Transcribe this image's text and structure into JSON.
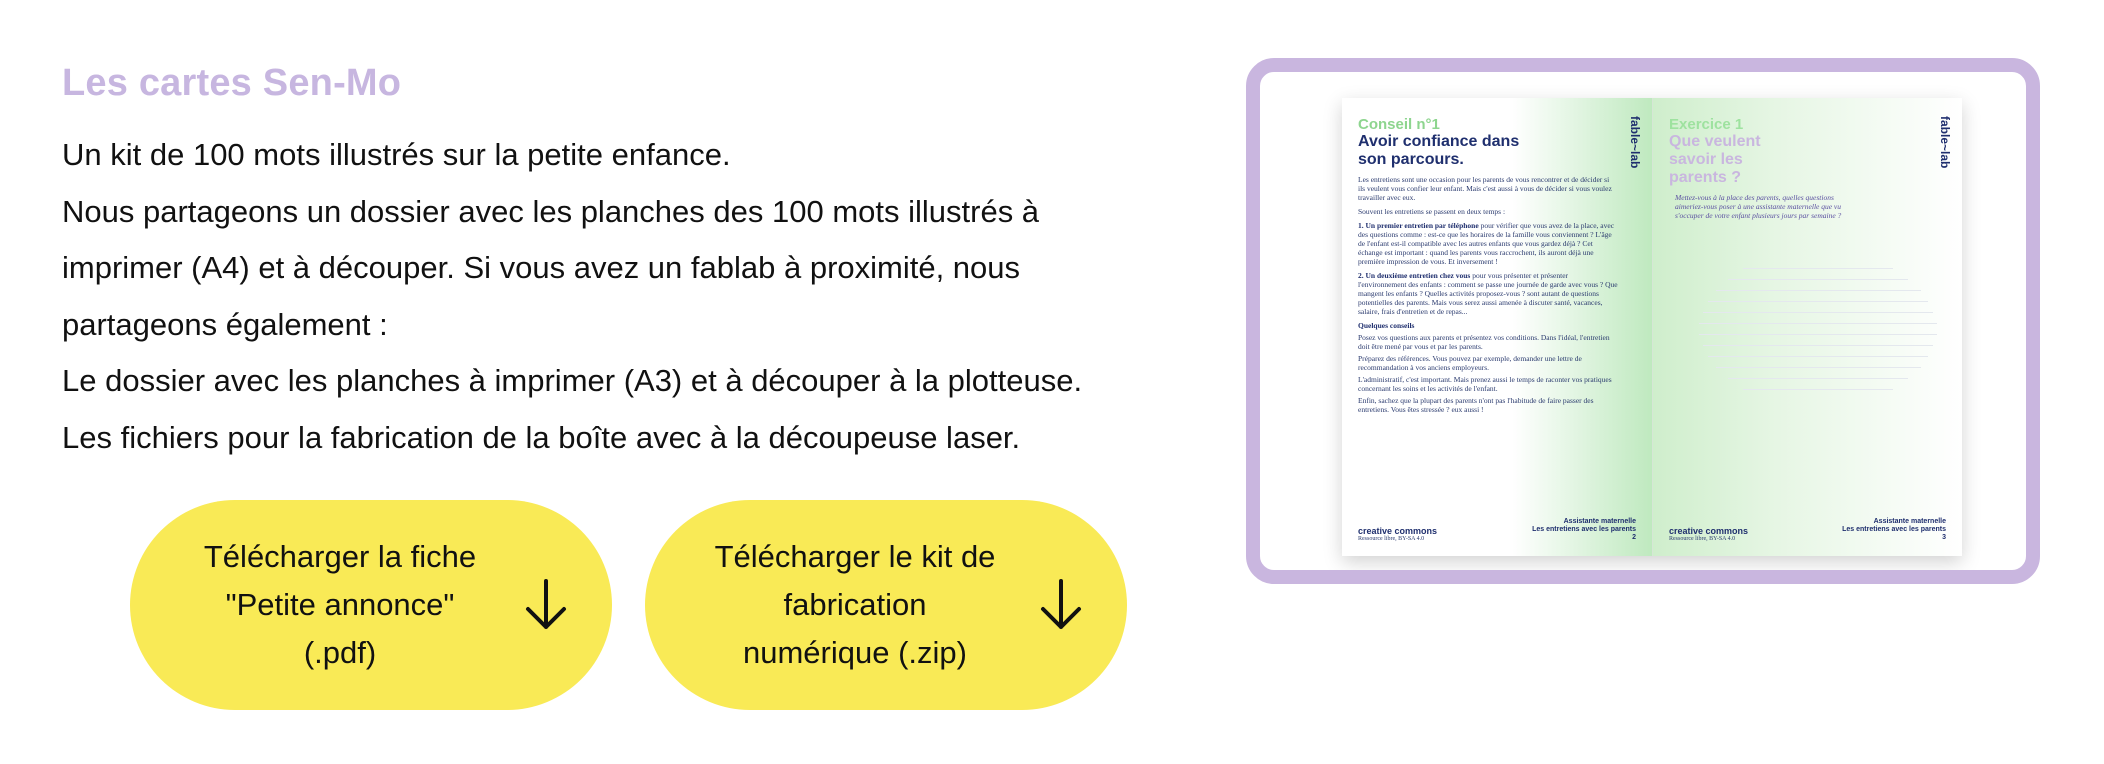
{
  "section": {
    "title": "Les cartes Sen-Mo",
    "paragraphs": [
      "Un kit de 100 mots illustrés sur la petite enfance.",
      "Nous partageons un dossier avec les planches des 100 mots illustrés à imprimer (A4) et à découper. Si vous avez un fablab à proximité, nous partageons également :",
      "Le dossier avec les planches à imprimer (A3) et à découper à la plotteuse.",
      "Les fichiers pour la fabrication de la boîte avec à la découpeuse laser."
    ]
  },
  "buttons": [
    {
      "label": "Télécharger la fiche\n\"Petite annonce\"\n(.pdf)",
      "icon": "arrow-down-icon"
    },
    {
      "label": "Télécharger le kit de\nfabrication\nnumérique (.zip)",
      "icon": "arrow-down-icon"
    }
  ],
  "preview": {
    "left_page": {
      "kicker": "Conseil n°1",
      "title": "Avoir confiance dans son parcours.",
      "brand": "fable~lab",
      "intro": "Les entretiens sont une occasion pour les parents de vous rencontrer et de décider si ils veulent vous confier leur enfant. Mais c'est aussi à vous de décider si vous voulez travailler avec eux.",
      "lead": "Souvent les entretiens se passent en deux temps :",
      "step1_bold": "1. Un premier entretien par téléphone",
      "step1_text": "pour vérifier que vous avez de la place, avec des questions comme : est-ce que les horaires de la famille vous conviennent ? L'âge de l'enfant est-il compatible avec les autres enfants que vous gardez déjà ? Cet échange est important : quand les parents vous raccrochent, ils auront déjà une première impression de vous. Et inversement !",
      "step2_bold": "2. Un deuxième entretien chez vous",
      "step2_text": "pour vous présenter et présenter l'environnement des enfants : comment se passe une journée de garde avec vous ? Que mangent les enfants ? Quelles activités proposez-vous ? sont autant de questions potentielles des parents. Mais vous serez aussi amenée à discuter santé, vacances, salaire, frais d'entretien et de repas...",
      "tips_title": "Quelques conseils",
      "tips": [
        "Posez vos questions aux parents et présentez vos conditions. Dans l'idéal, l'entretien doit être mené par vous et par les parents.",
        "Préparez des références. Vous pouvez par exemple, demander une lettre de recommandation à vos anciens employeurs.",
        "L'administratif, c'est important. Mais prenez aussi le temps de raconter vos pratiques concernant les soins et les activités de l'enfant.",
        "Enfin, sachez que la plupart des parents n'ont pas l'habitude de faire passer des entretiens. Vous êtes stressée ? eux aussi !"
      ],
      "cc_label": "creative commons",
      "license": "Ressource libre, BY-SA 4.0",
      "footer_title": "Assistante maternelle",
      "footer_sub": "Les entretiens avec les parents",
      "page_number": "2"
    },
    "right_page": {
      "kicker": "Exercice 1",
      "title": "Que veulent savoir les parents ?",
      "brand": "fable~lab",
      "prompt": "Mettez-vous à la place des parents, quelles questions aimeriez-vous poser à une assistante maternelle que vu s'occuper de votre enfant plusieurs jours par semaine ?",
      "cc_label": "creative commons",
      "license": "Ressource libre, BY-SA 4.0",
      "footer_title": "Assistante maternelle",
      "footer_sub": "Les entretiens avec les parents",
      "page_number": "3"
    }
  },
  "colors": {
    "title": "#c7b6e0",
    "button": "#f9ea56",
    "frame": "#c9b6df"
  }
}
